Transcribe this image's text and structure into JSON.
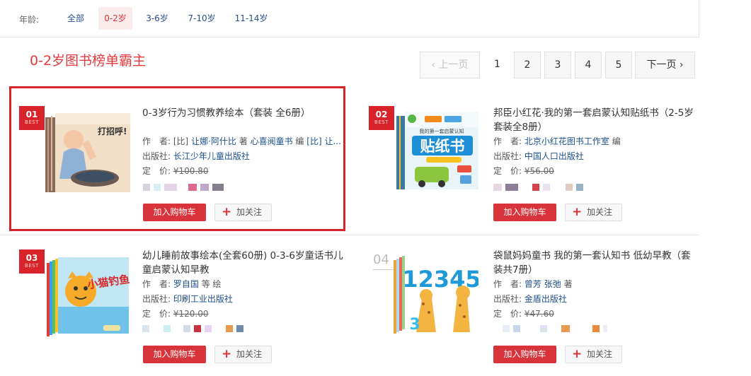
{
  "age_filter": {
    "label": "年龄:",
    "options": [
      {
        "label": "全部",
        "active": false
      },
      {
        "label": "0-2岁",
        "active": true
      },
      {
        "label": "3-6岁",
        "active": false
      },
      {
        "label": "7-10岁",
        "active": false
      },
      {
        "label": "11-14岁",
        "active": false
      }
    ]
  },
  "section_title": "0-2岁图书榜单霸主",
  "pagination": {
    "prev": "上一页",
    "prev_icon": "chevron-left-icon",
    "pages": [
      "1",
      "2",
      "3",
      "4",
      "5"
    ],
    "current": "1",
    "next": "下一页",
    "next_icon": "chevron-right-icon"
  },
  "labels": {
    "author": "作　者:",
    "publisher": "出版社:",
    "price": "定　价:",
    "add_to_cart": "加入购物车",
    "follow": "加关注",
    "follow_icon": "plus-icon",
    "best": "BEST"
  },
  "products": [
    {
      "rank": "01",
      "title": "0-3岁行为习惯教养绘本（套装 全6册）",
      "author_prefix": "[比]",
      "authors": [
        "让娜·阿什比"
      ],
      "author_role": "著",
      "translator": "心喜阅童书",
      "translator_role": "编",
      "author_more": "[比] 让...",
      "publisher": "长江少年儿童出版社",
      "price": "¥100.80",
      "cover_text": "打招呼!",
      "selected": true
    },
    {
      "rank": "02",
      "title": "邦臣小红花·我的第一套启蒙认知贴纸书（2-5岁 套装全8册）",
      "authors": [
        "北京小红花图书工作室"
      ],
      "author_role": "编",
      "publisher": "中国人口出版社",
      "price": "¥56.00",
      "cover_text": "贴纸书",
      "cover_sub": "我的第一套启蒙认知",
      "selected": false
    },
    {
      "rank": "03",
      "title": "幼儿睡前故事绘本(全套60册) 0-3-6岁童话书儿童启蒙认知早教",
      "authors": [
        "罗自国"
      ],
      "author_role": "等 绘",
      "publisher": "印刷工业出版社",
      "price": "¥120.00",
      "cover_text": "小猫钓鱼",
      "selected": false
    },
    {
      "rank": "04",
      "title": "袋鼠妈妈童书 我的第一套认知书 低幼早教（套装共7册）",
      "authors": [
        "曾芳",
        "张弛"
      ],
      "author_role": "著",
      "publisher": "金盾出版社",
      "price": "¥47.60",
      "cover_text": "12345",
      "selected": false
    }
  ]
}
